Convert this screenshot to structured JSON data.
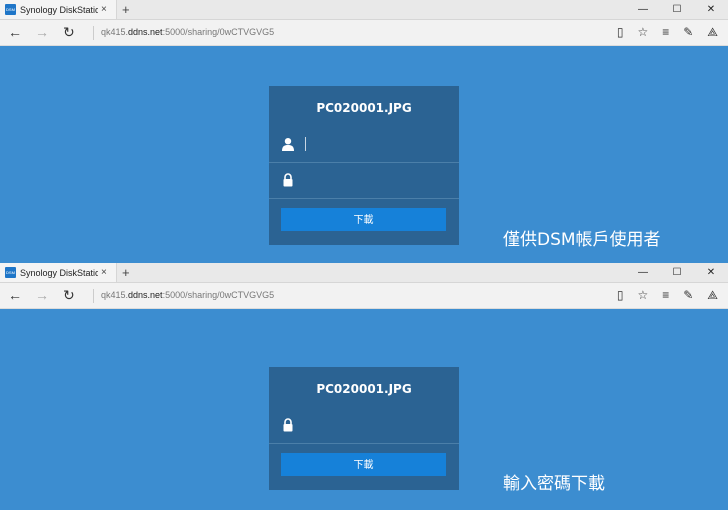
{
  "browser": {
    "tab_title": "Synology DiskStation - I",
    "favicon_text": "DSM",
    "tab_close": "×",
    "new_tab": "+",
    "url_prefix": "qk415.",
    "url_domain": "ddns.net",
    "url_suffix": ":5000/sharing/0wCTVGVG5",
    "minimize": "—",
    "maximize": "☐",
    "close": "✕"
  },
  "share": {
    "file_name": "PC020001.JPG",
    "download_label": "下載"
  },
  "captions": {
    "account_only": "僅供DSM帳戶使用者",
    "password": "輸入密碼下載"
  },
  "icons": {
    "user": "user-icon",
    "lock": "lock-icon"
  }
}
